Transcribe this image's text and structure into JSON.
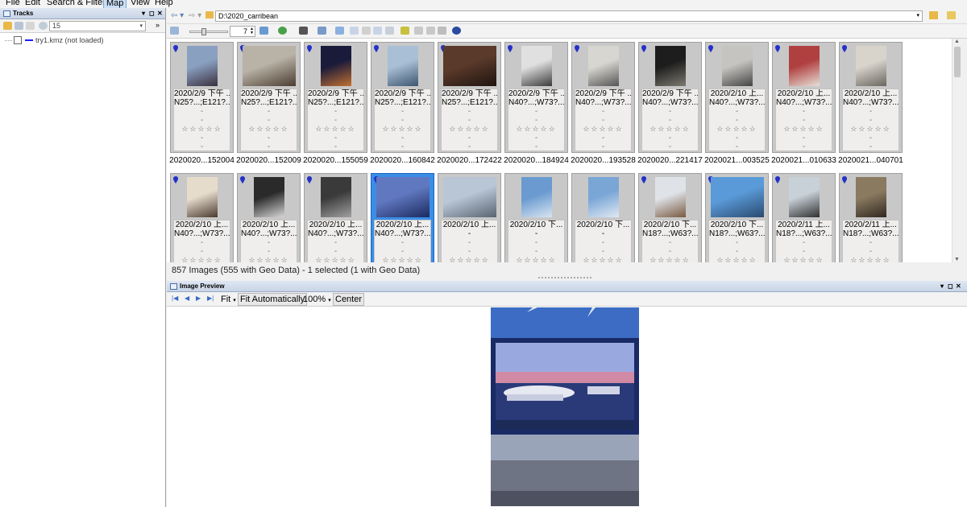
{
  "menu": {
    "items": [
      {
        "label": "File",
        "active": false
      },
      {
        "label": "Edit",
        "active": false
      },
      {
        "label": "Search & Filter",
        "active": false
      },
      {
        "label": "Map",
        "active": true
      },
      {
        "label": "View",
        "active": false
      },
      {
        "label": "Help",
        "active": false
      }
    ]
  },
  "tracks_panel": {
    "title": "Tracks",
    "zoom_value": "15",
    "tracks": [
      {
        "label": "try1.kmz (not loaded)",
        "checked": false,
        "color": "#1a1aff"
      }
    ]
  },
  "path_toolbar": {
    "path": "D:\\2020_carribean"
  },
  "icons_toolbar": {
    "columns_value": "7"
  },
  "thumbnails": [
    {
      "date": "2020/2/9 下午 ...",
      "coords": "N25?...;E121?...",
      "file": "2020020...152004",
      "geo": true,
      "selected": false,
      "c1": "#8aa0c0",
      "c2": "#3a3040",
      "land": false
    },
    {
      "date": "2020/2/9 下午 ...",
      "coords": "N25?...;E121?...",
      "file": "2020020...152009",
      "geo": true,
      "selected": false,
      "c1": "#b9b2a6",
      "c2": "#4b3c30",
      "land": true
    },
    {
      "date": "2020/2/9 下午 ...",
      "coords": "N25?...;E121?...",
      "file": "2020020...155059",
      "geo": true,
      "selected": false,
      "c1": "#1a1a3a",
      "c2": "#c07030",
      "land": false
    },
    {
      "date": "2020/2/9 下午 ...",
      "coords": "N25?...;E121?...",
      "file": "2020020...160842",
      "geo": true,
      "selected": false,
      "c1": "#a9bfd6",
      "c2": "#3e5670",
      "land": false
    },
    {
      "date": "2020/2/9 下午 ...",
      "coords": "N25?...;E121?...",
      "file": "2020020...172422",
      "geo": true,
      "selected": false,
      "c1": "#5a3a2a",
      "c2": "#1e1410",
      "land": true
    },
    {
      "date": "2020/2/9 下午 ...",
      "coords": "N40?...;W73?...",
      "file": "2020020...184924",
      "geo": true,
      "selected": false,
      "c1": "#e0e0e0",
      "c2": "#3a3a3a",
      "land": false
    },
    {
      "date": "2020/2/9 下午 ...",
      "coords": "N40?...;W73?...",
      "file": "2020020...193528",
      "geo": true,
      "selected": false,
      "c1": "#d8d6d0",
      "c2": "#555",
      "land": false
    },
    {
      "date": "2020/2/9 下午 ...",
      "coords": "N40?...;W73?...",
      "file": "2020020...221417",
      "geo": true,
      "selected": false,
      "c1": "#1d1d1d",
      "c2": "#7d7a70",
      "land": false
    },
    {
      "date": "2020/2/10 上...",
      "coords": "N40?...;W73?...",
      "file": "2020021...003525",
      "geo": true,
      "selected": false,
      "c1": "#c6c4c0",
      "c2": "#444",
      "land": false
    },
    {
      "date": "2020/2/10 上...",
      "coords": "N40?...;W73?...",
      "file": "2020021...010633",
      "geo": true,
      "selected": false,
      "c1": "#b04040",
      "c2": "#e6e0d8",
      "land": false
    },
    {
      "date": "2020/2/10 上...",
      "coords": "N40?...;W73?...",
      "file": "2020021...040701",
      "geo": true,
      "selected": false,
      "c1": "#d8d4cc",
      "c2": "#6a6660",
      "land": false
    },
    {
      "date": "2020/2/10 上...",
      "coords": "N40?...;W73?...",
      "file": "",
      "geo": true,
      "selected": false,
      "c1": "#e6dccc",
      "c2": "#4a3a30",
      "land": false
    },
    {
      "date": "2020/2/10 上...",
      "coords": "N40?...;W73?...",
      "file": "",
      "geo": true,
      "selected": false,
      "c1": "#2a2a2a",
      "c2": "#d6d6d6",
      "land": false
    },
    {
      "date": "2020/2/10 上...",
      "coords": "N40?...;W73?...",
      "file": "",
      "geo": true,
      "selected": false,
      "c1": "#3a3a3a",
      "c2": "#a0a0a0",
      "land": false
    },
    {
      "date": "2020/2/10 上...",
      "coords": "N40?...;W73?...",
      "file": "",
      "geo": true,
      "selected": true,
      "c1": "#6078c0",
      "c2": "#1c2a60",
      "land": true
    },
    {
      "date": "2020/2/10 上...",
      "coords": "-",
      "file": "",
      "geo": false,
      "selected": false,
      "c1": "#b8c6d6",
      "c2": "#5a6470",
      "land": true
    },
    {
      "date": "2020/2/10 下...",
      "coords": "-",
      "file": "",
      "geo": false,
      "selected": false,
      "c1": "#6a9ad0",
      "c2": "#d8e4f0",
      "land": false
    },
    {
      "date": "2020/2/10 下...",
      "coords": "-",
      "file": "",
      "geo": false,
      "selected": false,
      "c1": "#7aa6d6",
      "c2": "#e0e8f2",
      "land": false
    },
    {
      "date": "2020/2/10 下...",
      "coords": "N18?...;W63?...",
      "file": "",
      "geo": true,
      "selected": false,
      "c1": "#dfe3e8",
      "c2": "#7a5a40",
      "land": false
    },
    {
      "date": "2020/2/10 下...",
      "coords": "N18?...;W63?...",
      "file": "",
      "geo": true,
      "selected": false,
      "c1": "#5a9ad8",
      "c2": "#2a4a70",
      "land": true
    },
    {
      "date": "2020/2/11 上...",
      "coords": "N18?...;W63?...",
      "file": "",
      "geo": true,
      "selected": false,
      "c1": "#c8d0d8",
      "c2": "#303030",
      "land": false
    },
    {
      "date": "2020/2/11 上...",
      "coords": "N18?...;W63?...",
      "file": "",
      "geo": true,
      "selected": false,
      "c1": "#8a7a60",
      "c2": "#302820",
      "land": false
    }
  ],
  "status": {
    "text": "857 Images (555 with Geo Data) - 1 selected (1 with Geo Data)"
  },
  "preview_panel": {
    "title": "Image Preview",
    "fit_label": "Fit",
    "fit_auto_label": "Fit Automatically",
    "zoom_label": "100%",
    "center_label": "Center"
  },
  "icons": {
    "thumb_geo_pin": "map-pin-icon",
    "nav_first": "first-page-icon",
    "nav_prev": "previous-icon",
    "nav_next": "next-icon",
    "nav_last": "last-page-icon"
  },
  "colors": {
    "selection": "#3a8ee6",
    "pin": "#2430c8",
    "menu_active": "#c9def5"
  }
}
